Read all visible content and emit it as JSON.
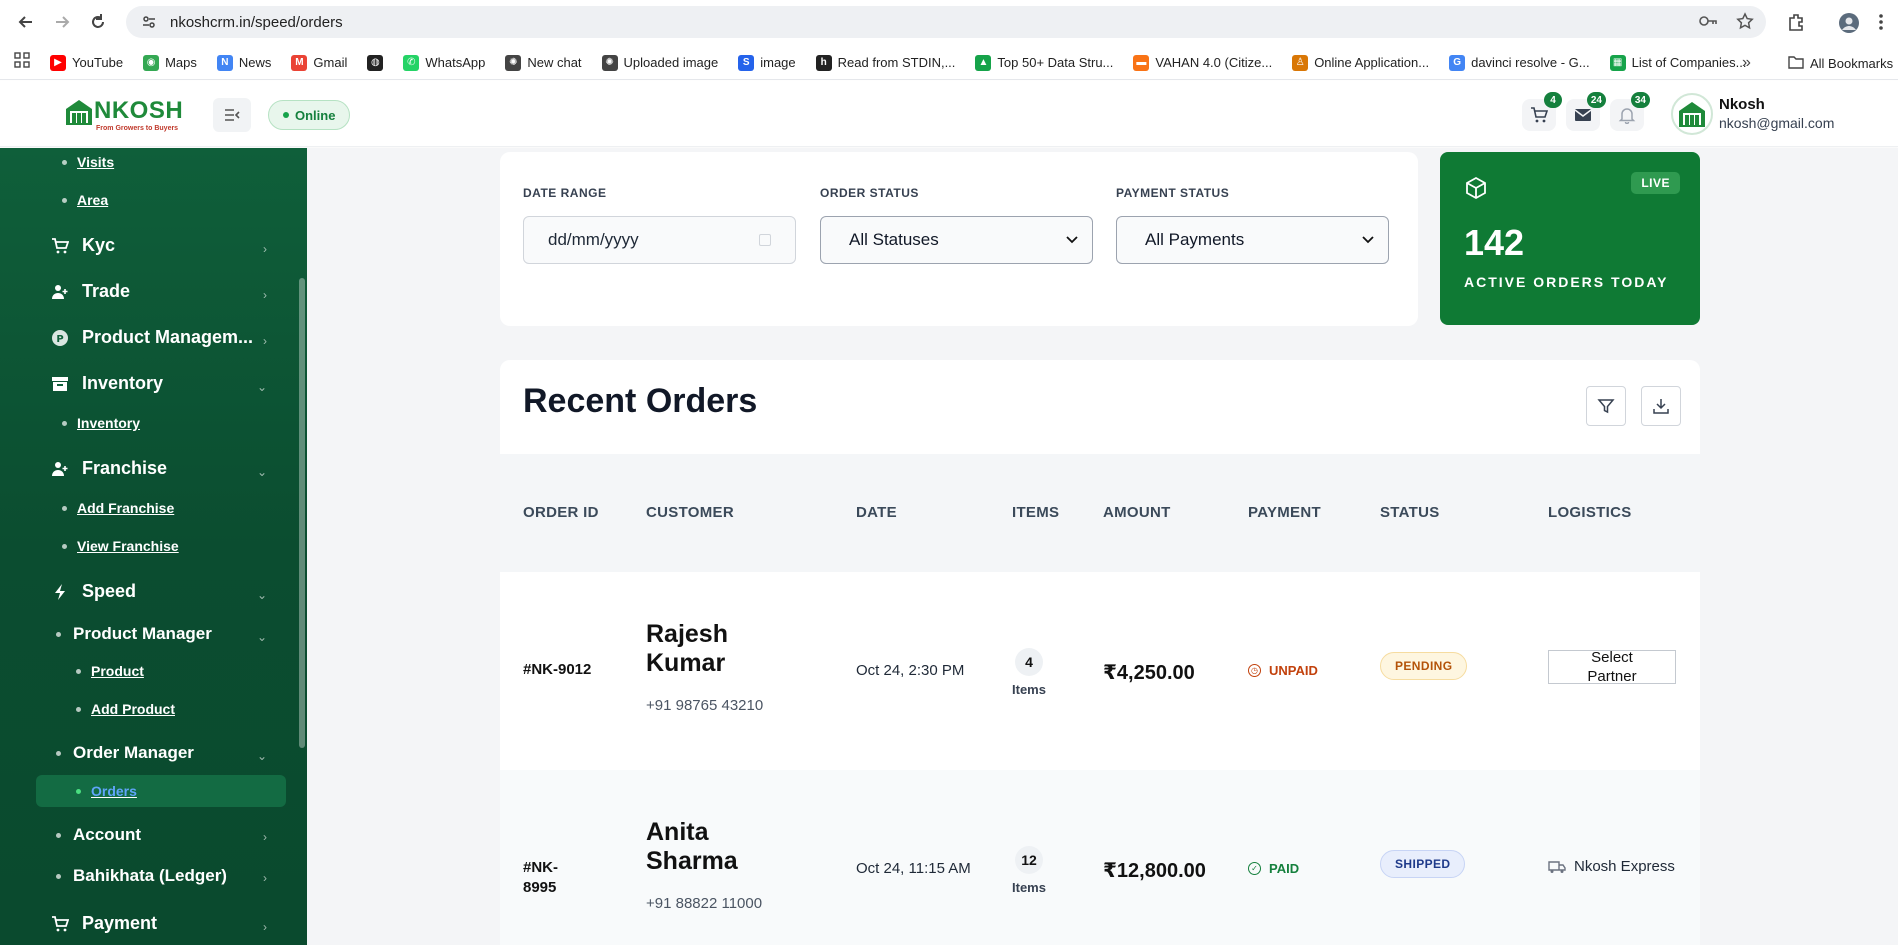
{
  "browser": {
    "url": "nkoshcrm.in/speed/orders",
    "bookmarks": [
      {
        "label": "YouTube",
        "color": "#ff0000",
        "glyph": "▶"
      },
      {
        "label": "Maps",
        "color": "#34a853",
        "glyph": "◉"
      },
      {
        "label": "News",
        "color": "#4285f4",
        "glyph": "N"
      },
      {
        "label": "Gmail",
        "color": "#ea4335",
        "glyph": "M"
      },
      {
        "label": "",
        "color": "#222222",
        "glyph": "◍"
      },
      {
        "label": "WhatsApp",
        "color": "#25d366",
        "glyph": "✆"
      },
      {
        "label": "New chat",
        "color": "#444444",
        "glyph": "✺"
      },
      {
        "label": "Uploaded image",
        "color": "#444444",
        "glyph": "✺"
      },
      {
        "label": "image",
        "color": "#2563eb",
        "glyph": "S"
      },
      {
        "label": "Read from STDIN,...",
        "color": "#222222",
        "glyph": "h"
      },
      {
        "label": "Top 50+ Data Stru...",
        "color": "#16a34a",
        "glyph": "▲"
      },
      {
        "label": "VAHAN 4.0 (Citize...",
        "color": "#f97316",
        "glyph": "▬"
      },
      {
        "label": "Online Application...",
        "color": "#d97706",
        "glyph": "♙"
      },
      {
        "label": "davinci resolve - G...",
        "color": "#4285f4",
        "glyph": "G"
      },
      {
        "label": "List of Companies...",
        "color": "#16a34a",
        "glyph": "▦"
      }
    ],
    "more": "»",
    "all_bookmarks": "All Bookmarks"
  },
  "header": {
    "logo_word": "NKOSH",
    "logo_tag": "From Growers to Buyers",
    "status": "Online",
    "cart_count": "4",
    "mail_count": "24",
    "notif_count": "34",
    "user_name": "Nkosh",
    "user_email": "nkosh@gmail.com"
  },
  "sidebar": {
    "visits": "Visits",
    "area": "Area",
    "kyc": "Kyc",
    "trade": "Trade",
    "product_management": "Product Managem...",
    "inventory": "Inventory",
    "inventory_sub": "Inventory",
    "franchise": "Franchise",
    "add_franchise": "Add Franchise",
    "view_franchise": "View Franchise",
    "speed": "Speed",
    "product_manager": "Product Manager",
    "product": "Product",
    "add_product": "Add Product",
    "order_manager": "Order Manager",
    "orders": "Orders",
    "account": "Account",
    "bahikhata": "Bahikhata (Ledger)",
    "payment": "Payment"
  },
  "filters": {
    "date_label": "DATE RANGE",
    "date_placeholder": "dd/mm/yyyy",
    "order_status_label": "ORDER STATUS",
    "order_status_value": "All Statuses",
    "payment_status_label": "PAYMENT STATUS",
    "payment_status_value": "All Payments"
  },
  "live": {
    "badge": "LIVE",
    "count": "142",
    "label": "ACTIVE ORDERS TODAY"
  },
  "orders": {
    "title": "Recent Orders",
    "columns": [
      "ORDER ID",
      "CUSTOMER",
      "DATE",
      "ITEMS",
      "AMOUNT",
      "PAYMENT",
      "STATUS",
      "LOGISTICS"
    ],
    "rows": [
      {
        "id": "#NK-9012",
        "name": "Rajesh Kumar",
        "phone": "+91 98765 43210",
        "date": "Oct 24, 2:30 PM",
        "items": "4",
        "items_label": "Items",
        "amount": "₹4,250.00",
        "payment": "UNPAID",
        "status": "PENDING",
        "logistics": "Select Partner"
      },
      {
        "id": "#NK-8995",
        "name": "Anita Sharma",
        "phone": "+91 88822 11000",
        "date": "Oct 24, 11:15 AM",
        "items": "12",
        "items_label": "Items",
        "amount": "₹12,800.00",
        "payment": "PAID",
        "status": "SHIPPED",
        "logistics": "Nkosh Express"
      }
    ]
  },
  "colors": {
    "brand_green": "#0f7a34",
    "unpaid": "#c2410c",
    "paid": "#15803d",
    "pending_bg": "#fef6e0",
    "pending_fg": "#b45309",
    "shipped_bg": "#e8eefc",
    "shipped_fg": "#1e3a8a"
  }
}
